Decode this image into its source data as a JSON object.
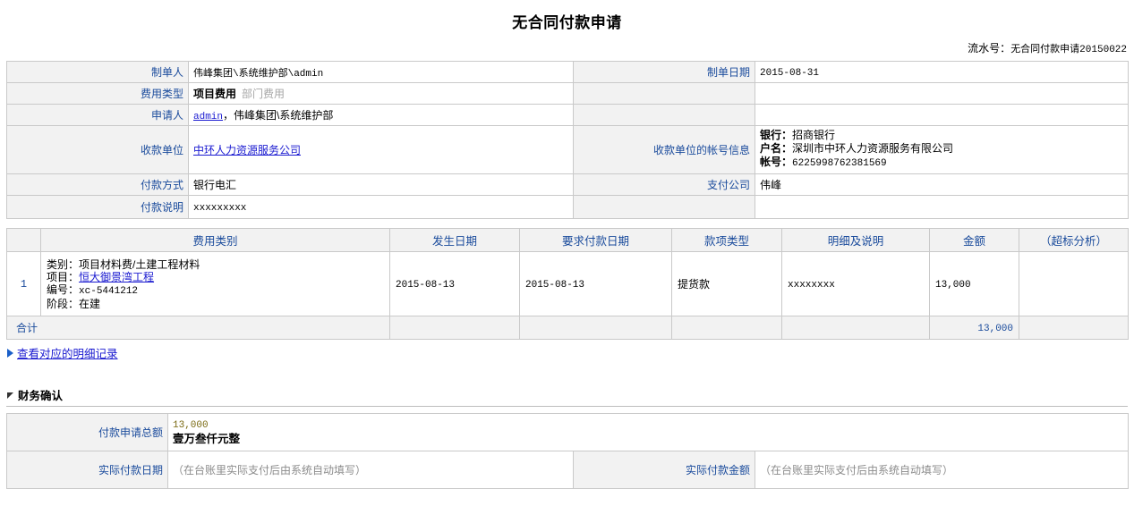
{
  "document": {
    "title": "无合同付款申请",
    "serial_label": "流水号：",
    "serial_value": "无合同付款申请20150022"
  },
  "form": {
    "rows": {
      "preparer_label": "制单人",
      "preparer_value": "伟峰集团\\系统维护部\\admin",
      "prepare_date_label": "制单日期",
      "prepare_date_value": "2015-08-31",
      "expense_type_label": "费用类型",
      "expense_type_selected": "项目费用",
      "expense_type_unselected": "部门费用",
      "applicant_label": "申请人",
      "applicant_link": "admin",
      "applicant_rest": "，伟峰集团\\系统维护部",
      "payee_label": "收款单位",
      "payee_value": "中环人力资源服务公司",
      "payee_account_label": "收款单位的帐号信息",
      "payee_bank_key": "银行：",
      "payee_bank_value": "招商银行",
      "payee_name_key": "户名：",
      "payee_name_value": "深圳市中环人力资源服务有限公司",
      "payee_acct_key": "帐号：",
      "payee_acct_value": "6225998762381569",
      "pay_method_label": "付款方式",
      "pay_method_value": "银行电汇",
      "pay_company_label": "支付公司",
      "pay_company_value": "伟峰",
      "pay_note_label": "付款说明",
      "pay_note_value": "xxxxxxxxx"
    }
  },
  "detail_table": {
    "headers": [
      "",
      "费用类别",
      "发生日期",
      "要求付款日期",
      "款项类型",
      "明细及说明",
      "金额",
      "（超标分析）"
    ],
    "rows": [
      {
        "no": "1",
        "category_key": "类别：",
        "category_value": "项目材料费/土建工程材料",
        "project_key": "项目：",
        "project_value": "恒大御景湾工程",
        "code_key": "编号：",
        "code_value": "xc-5441212",
        "stage_key": "阶段：",
        "stage_value": "在建",
        "occur_date": "2015-08-13",
        "required_date": "2015-08-13",
        "payment_type": "提货款",
        "description": "xxxxxxxx",
        "amount": "13,000",
        "overrun": ""
      }
    ],
    "summary_label": "合计",
    "summary_amount": "13,000"
  },
  "detail_link": {
    "label": "查看对应的明细记录"
  },
  "finance_section": {
    "heading": "财务确认",
    "total_label": "付款申请总额",
    "total_number": "13,000",
    "total_chinese": "壹万叁仟元整",
    "actual_date_label": "实际付款日期",
    "actual_date_placeholder": "（在台账里实际支付后由系统自动填写）",
    "actual_amount_label": "实际付款金额",
    "actual_amount_placeholder": "（在台账里实际支付后由系统自动填写）"
  },
  "colors": {
    "label_text": "#1a4b9c",
    "link": "#1a1ad0",
    "label_bg": "#f2f2f2",
    "border": "#c9c9c9"
  }
}
